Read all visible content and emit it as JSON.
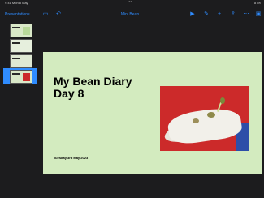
{
  "status_bar": {
    "time": "9:41 Mon 8 May",
    "dots": "•••",
    "battery": "87%"
  },
  "toolbar": {
    "back_label": "Presentations",
    "title": "Mini Bean",
    "icons": [
      "sidebar-icon",
      "undo-icon",
      "play-icon",
      "brush-icon",
      "plus-icon",
      "share-icon",
      "more-icon",
      "format-icon"
    ]
  },
  "navigator": {
    "slides": [
      {
        "number": "1"
      },
      {
        "number": "2"
      },
      {
        "number": "3"
      },
      {
        "number": "4",
        "selected": true
      }
    ]
  },
  "slide": {
    "title_line1": "My Bean Diary",
    "title_line2": "Day 8",
    "date": "Tuesday 3rd May 2023"
  },
  "colors": {
    "accent": "#2f8cff",
    "slide_bg": "#d3ebbf",
    "chrome_bg": "#1c1c1e"
  }
}
